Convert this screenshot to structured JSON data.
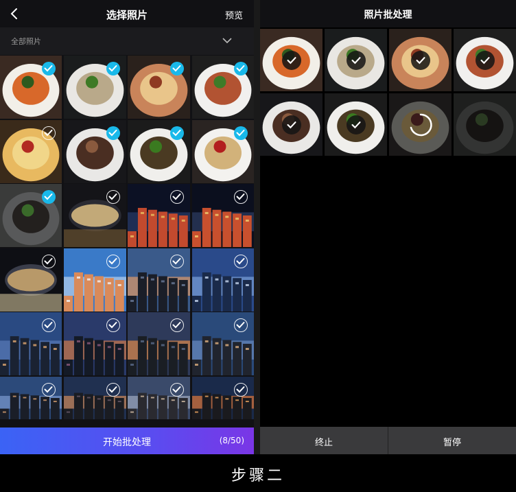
{
  "left": {
    "title": "选择照片",
    "preview_label": "预览",
    "filter_label": "全部照片",
    "start_label": "开始批处理",
    "count_label": "(8/50)",
    "photos": [
      {
        "name": "photo-shrimp-bowl",
        "selected": true,
        "palette": [
          "#3a2a22",
          "#f2efe8",
          "#d8682a",
          "#2e5a1e"
        ]
      },
      {
        "name": "photo-fish-salad",
        "selected": true,
        "palette": [
          "#1a1c1d",
          "#e9e7e3",
          "#b9a98a",
          "#3e7a26"
        ]
      },
      {
        "name": "photo-pizza",
        "selected": true,
        "palette": [
          "#2a211c",
          "#c9845a",
          "#e9c58a",
          "#8f3a22"
        ]
      },
      {
        "name": "photo-pasta",
        "selected": true,
        "palette": [
          "#1e1e1e",
          "#f1f0ee",
          "#b25332",
          "#3d7b28"
        ]
      },
      {
        "name": "photo-pizza-closeup",
        "selected": false,
        "palette": [
          "#3a2a1a",
          "#e8b960",
          "#f1d689",
          "#b22a22"
        ]
      },
      {
        "name": "photo-cake-time",
        "selected": true,
        "palette": [
          "#17171a",
          "#e9e8e6",
          "#4a2e22",
          "#8a5a3e"
        ]
      },
      {
        "name": "photo-noodles",
        "selected": true,
        "palette": [
          "#1b1b1b",
          "#f0efec",
          "#4a3a22",
          "#3a7a20"
        ]
      },
      {
        "name": "photo-soup-bowl",
        "selected": true,
        "palette": [
          "#2a2422",
          "#f3f2ef",
          "#d2b27a",
          "#b21e1e"
        ]
      },
      {
        "name": "photo-steak",
        "selected": true,
        "palette": [
          "#3a3b3a",
          "#58595a",
          "#23201e",
          "#3a6a2a"
        ]
      },
      {
        "name": "photo-opera-night",
        "selected": false,
        "palette": [
          "#141418",
          "#2a2b33",
          "#e8c98a",
          "#8a6a3a"
        ]
      },
      {
        "name": "photo-gate-night",
        "selected": false,
        "palette": [
          "#0c1124",
          "#283a6a",
          "#c24a2e",
          "#e8c060"
        ]
      },
      {
        "name": "photo-gate-street",
        "selected": false,
        "palette": [
          "#0b0f1e",
          "#2d3d62",
          "#c8502e",
          "#f0d070"
        ]
      },
      {
        "name": "photo-opera-lights",
        "selected": false,
        "palette": [
          "#0e0f14",
          "#3a3d4a",
          "#d8b070",
          "#f2e2b0"
        ]
      },
      {
        "name": "photo-tower-sky",
        "selected": false,
        "palette": [
          "#3a7ac8",
          "#b8d2ee",
          "#d98a5a",
          "#f2f4f6"
        ]
      },
      {
        "name": "photo-city-dusk",
        "selected": false,
        "palette": [
          "#3a5a8a",
          "#e09a6a",
          "#1a1e28",
          "#6a7a9a"
        ]
      },
      {
        "name": "photo-glass-tower",
        "selected": false,
        "palette": [
          "#2a4a8a",
          "#7aa0d8",
          "#1a2a4a",
          "#c8d8f0"
        ]
      },
      {
        "name": "photo-city-blue",
        "selected": false,
        "palette": [
          "#2a4a82",
          "#5a7ab8",
          "#1a2232",
          "#e0a870"
        ]
      },
      {
        "name": "photo-sunset-towers",
        "selected": false,
        "palette": [
          "#2a3a6a",
          "#d27a4a",
          "#141a26",
          "#8a5a7a"
        ]
      },
      {
        "name": "photo-sunset-low",
        "selected": false,
        "palette": [
          "#2e3a5a",
          "#e08a4a",
          "#1a1e24",
          "#5a6a8a"
        ]
      },
      {
        "name": "photo-city-evening",
        "selected": false,
        "palette": [
          "#2a4a7a",
          "#6a8ac0",
          "#20242e",
          "#e0b080"
        ]
      },
      {
        "name": "photo-skyline-blue",
        "selected": false,
        "palette": [
          "#2c4a7a",
          "#7a9ad0",
          "#1a1e28",
          "#d8a070"
        ]
      },
      {
        "name": "photo-skyline-orange",
        "selected": false,
        "palette": [
          "#203050",
          "#d08a5a",
          "#1a1c22",
          "#6a5a6a"
        ]
      },
      {
        "name": "photo-apartments",
        "selected": false,
        "palette": [
          "#3a4a6a",
          "#a0aac0",
          "#2a2a30",
          "#d8c0a8"
        ]
      },
      {
        "name": "photo-sunset-fire",
        "selected": false,
        "palette": [
          "#1a2a4a",
          "#e0783a",
          "#1a1a1e",
          "#f0a860"
        ]
      }
    ]
  },
  "right": {
    "title": "照片批处理",
    "stop_label": "终止",
    "pause_label": "暂停",
    "photos": [
      {
        "name": "done-shrimp-bowl",
        "state": "done",
        "palette": [
          "#3a2a22",
          "#f2efe8",
          "#d8682a",
          "#2e5a1e"
        ]
      },
      {
        "name": "done-fish-salad",
        "state": "done",
        "palette": [
          "#1a1c1d",
          "#e9e7e3",
          "#b9a98a",
          "#3e7a26"
        ]
      },
      {
        "name": "done-pizza",
        "state": "done",
        "palette": [
          "#2a211c",
          "#c9845a",
          "#e9c58a",
          "#8f3a22"
        ]
      },
      {
        "name": "done-pasta",
        "state": "done",
        "palette": [
          "#1e1e1e",
          "#f1f0ee",
          "#b25332",
          "#3d7b28"
        ]
      },
      {
        "name": "done-cake-time",
        "state": "done",
        "palette": [
          "#17171a",
          "#e9e8e6",
          "#4a2e22",
          "#8a5a3e"
        ]
      },
      {
        "name": "done-noodles",
        "state": "done",
        "palette": [
          "#1b1b1b",
          "#f0efec",
          "#4a3a22",
          "#3a7a20"
        ]
      },
      {
        "name": "processing-soup-bowl",
        "state": "processing",
        "palette": [
          "#1a1818",
          "#5a5a56",
          "#6a5a3a",
          "#3a1a1a"
        ]
      },
      {
        "name": "pending-steak",
        "state": "pending",
        "palette": [
          "#1e1f1e",
          "#333433",
          "#151312",
          "#2a3a22"
        ]
      }
    ]
  },
  "caption": "步骤二",
  "colors": {
    "accent": "#19b9ea",
    "gradient_start": "#3b63f5",
    "gradient_end": "#7a36e6",
    "bottom_bar": "#3a3a3c"
  }
}
